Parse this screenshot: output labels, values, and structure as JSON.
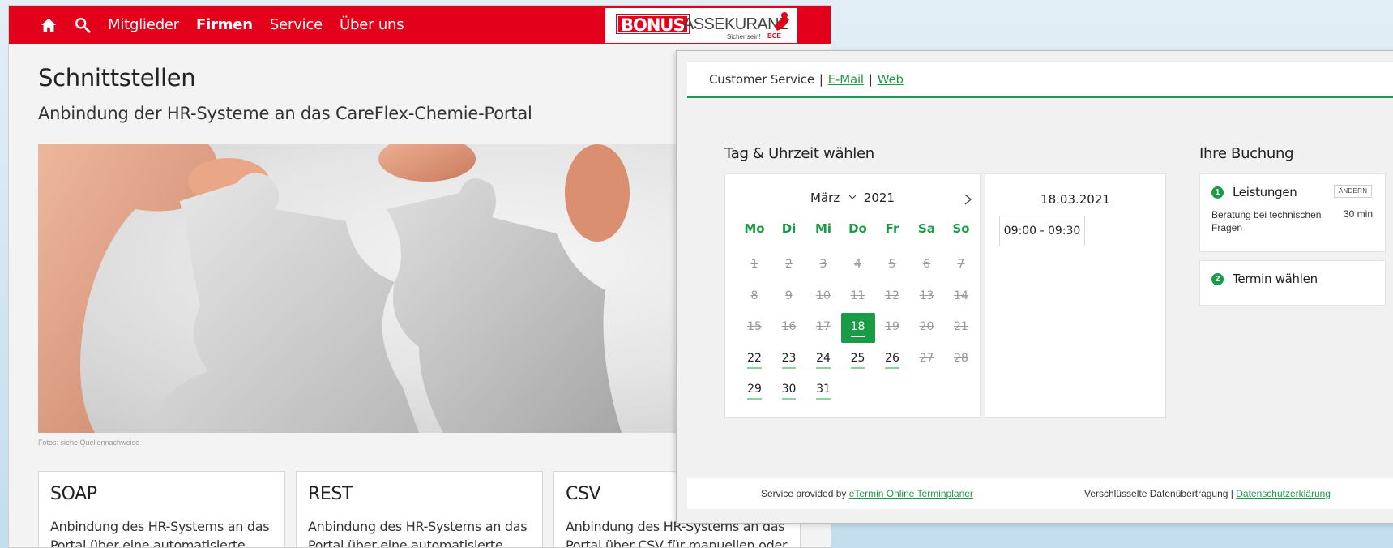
{
  "site": {
    "nav": {
      "items": [
        "Mitglieder",
        "Firmen",
        "Service",
        "Über uns"
      ],
      "active_index": 1
    },
    "logo": {
      "brand_part1": "BONUS",
      "brand_part2": "ASSEKURANZ",
      "slogan": "Sicher sein!",
      "partner": "BCE"
    },
    "title": "Schnittstellen",
    "subtitle": "Anbindung der HR-Systeme an das CareFlex-Chemie-Portal",
    "photo_credit": "Fotos: siehe Quellennachweise",
    "cards": [
      {
        "title": "SOAP",
        "text": "Anbindung des HR-Systems an das Portal über eine automatisierte SOAP-"
      },
      {
        "title": "REST",
        "text": "Anbindung des HR-Systems an das Portal über eine automatisierte REST-"
      },
      {
        "title": "CSV",
        "text": "Anbindung des HR-Systems an das Portal über CSV für manuellen oder"
      }
    ],
    "accent_color": "#e3001b"
  },
  "popup": {
    "customer_service": "Customer Service",
    "email_link": "E-Mail",
    "web_link": "Web",
    "section_title": "Tag & Uhrzeit wählen",
    "calendar": {
      "month": "März",
      "year": "2021",
      "weekdays": [
        "Mo",
        "Di",
        "Mi",
        "Do",
        "Fr",
        "Sa",
        "So"
      ],
      "days": [
        {
          "d": "1",
          "s": "disabled"
        },
        {
          "d": "2",
          "s": "disabled"
        },
        {
          "d": "3",
          "s": "disabled"
        },
        {
          "d": "4",
          "s": "disabled"
        },
        {
          "d": "5",
          "s": "disabled"
        },
        {
          "d": "6",
          "s": "disabled"
        },
        {
          "d": "7",
          "s": "disabled"
        },
        {
          "d": "8",
          "s": "disabled"
        },
        {
          "d": "9",
          "s": "disabled"
        },
        {
          "d": "10",
          "s": "disabled"
        },
        {
          "d": "11",
          "s": "disabled"
        },
        {
          "d": "12",
          "s": "disabled"
        },
        {
          "d": "13",
          "s": "disabled"
        },
        {
          "d": "14",
          "s": "disabled"
        },
        {
          "d": "15",
          "s": "disabled"
        },
        {
          "d": "16",
          "s": "disabled"
        },
        {
          "d": "17",
          "s": "disabled"
        },
        {
          "d": "18",
          "s": "selected"
        },
        {
          "d": "19",
          "s": "disabled"
        },
        {
          "d": "20",
          "s": "disabled"
        },
        {
          "d": "21",
          "s": "disabled"
        },
        {
          "d": "22",
          "s": "avail"
        },
        {
          "d": "23",
          "s": "avail"
        },
        {
          "d": "24",
          "s": "avail"
        },
        {
          "d": "25",
          "s": "avail"
        },
        {
          "d": "26",
          "s": "avail"
        },
        {
          "d": "27",
          "s": "disabled"
        },
        {
          "d": "28",
          "s": "disabled"
        },
        {
          "d": "29",
          "s": "avail"
        },
        {
          "d": "30",
          "s": "avail"
        },
        {
          "d": "31",
          "s": "avail"
        }
      ]
    },
    "selected_date": "18.03.2021",
    "time_slot": "09:00 - 09:30",
    "booking": {
      "title": "Ihre Buchung",
      "step1": {
        "number": "1",
        "label": "Leistungen",
        "change": "ÄNDERN",
        "service": "Beratung bei technischen Fragen",
        "duration": "30 min"
      },
      "step2": {
        "number": "2",
        "label": "Termin wählen"
      }
    },
    "footer": {
      "provided_by": "Service provided by",
      "provider_link": "eTermin Online Terminplaner",
      "encryption": "Verschlüsselte Datenübertragung |",
      "privacy_link": "Datenschutzerklärung"
    },
    "accent_color": "#1a9b46"
  }
}
